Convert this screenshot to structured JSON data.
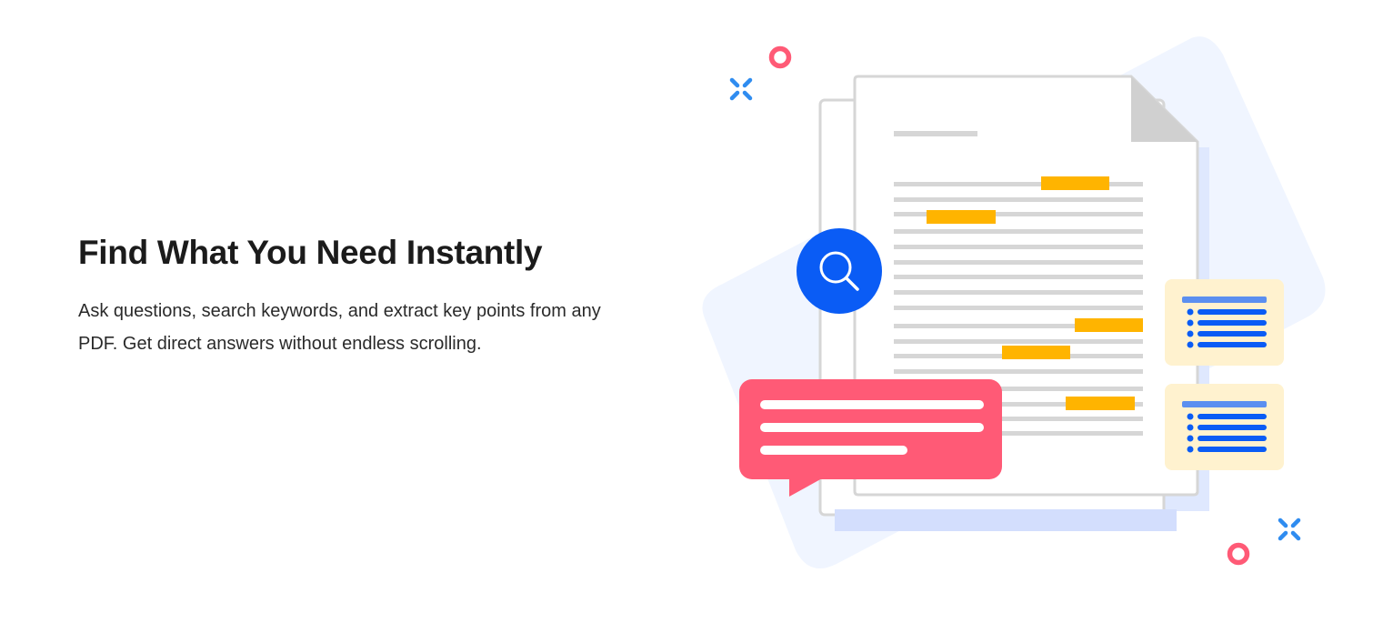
{
  "feature": {
    "title": "Find What You Need Instantly",
    "description": "Ask questions, search keywords, and extract key points from any PDF. Get direct answers without endless scrolling."
  },
  "illustration": {
    "icons": [
      "search-icon",
      "chat-bubble-icon",
      "list-card-icon",
      "sparkle-icon",
      "ring-icon"
    ],
    "colors": {
      "background_blob": "#e4edff",
      "page_border": "#d6d6d6",
      "highlight": "#ffb400",
      "search_circle": "#0a5cf5",
      "chat_bubble": "#ff5a76",
      "list_card": "#fff2cf",
      "list_accent": "#0a5cf5",
      "sparkle": "#2f8cf0",
      "ring": "#ff5a76"
    }
  }
}
